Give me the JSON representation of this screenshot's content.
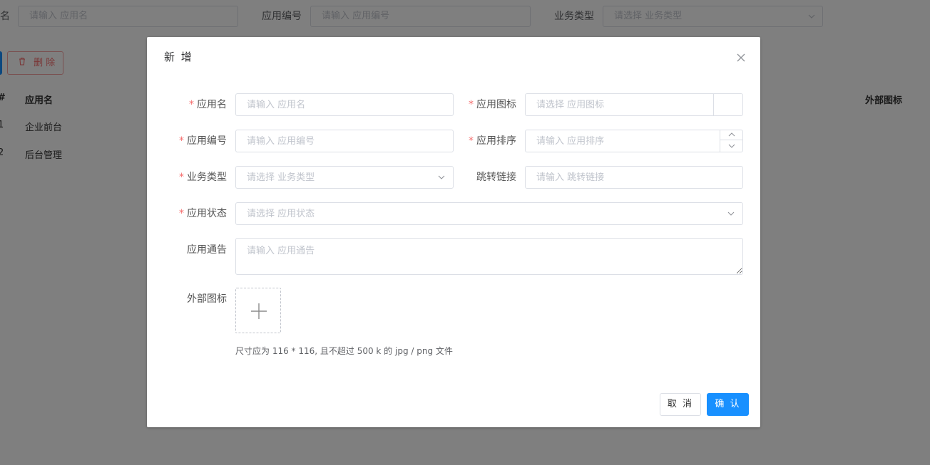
{
  "background": {
    "filters": [
      {
        "label": "名",
        "placeholder": "请输入 应用名"
      },
      {
        "label": "应用编号",
        "placeholder": "请输入 应用编号"
      },
      {
        "label": "业务类型",
        "placeholder": "请选择 业务类型"
      }
    ],
    "delete_label": "删 除",
    "table": {
      "headers": [
        "#",
        "应用名",
        "外部图标"
      ],
      "rows": [
        {
          "index": "1",
          "name": "企业前台"
        },
        {
          "index": "2",
          "name": "后台管理"
        }
      ]
    }
  },
  "dialog": {
    "title": "新 增",
    "fields": {
      "app_name": {
        "label": "应用名",
        "required": "*",
        "placeholder": "请输入 应用名"
      },
      "app_icon": {
        "label": "应用图标",
        "required": "*",
        "placeholder": "请选择 应用图标"
      },
      "app_code": {
        "label": "应用编号",
        "required": "*",
        "placeholder": "请输入 应用编号"
      },
      "app_sort": {
        "label": "应用排序",
        "required": "*",
        "placeholder": "请输入 应用排序"
      },
      "biz_type": {
        "label": "业务类型",
        "required": "*",
        "placeholder": "请选择 业务类型"
      },
      "jump_link": {
        "label": "跳转链接",
        "placeholder": "请输入 跳转链接"
      },
      "app_status": {
        "label": "应用状态",
        "required": "*",
        "placeholder": "请选择 应用状态"
      },
      "app_notice": {
        "label": "应用通告",
        "placeholder": "请输入 应用通告"
      },
      "external_icon": {
        "label": "外部图标"
      }
    },
    "upload_hint": "尺寸应为 116 * 116, 且不超过 500 k 的 jpg / png 文件",
    "cancel_label": "取 消",
    "confirm_label": "确 认"
  },
  "colors": {
    "primary": "#1890ff",
    "danger": "#f56c6c",
    "mask": "rgba(0,0,0,0.5)"
  }
}
